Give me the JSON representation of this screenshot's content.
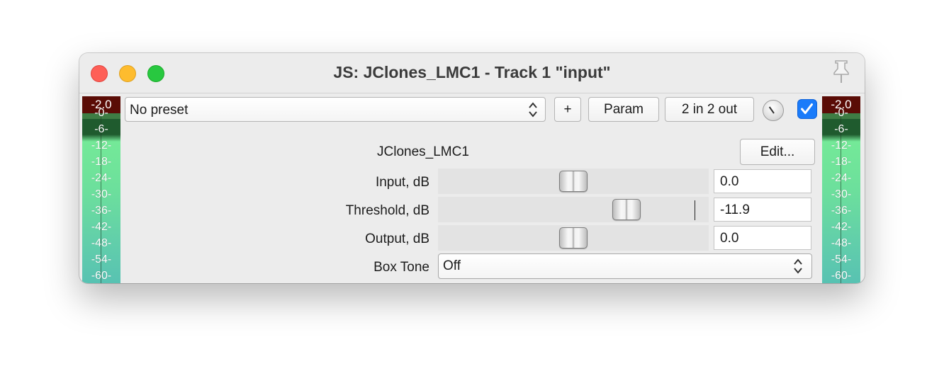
{
  "window": {
    "title": "JS: JClones_LMC1 - Track 1 \"input\""
  },
  "meters": {
    "left": {
      "peak": "-2.0",
      "ticks": [
        "-0-",
        "-6-",
        "-12-",
        "-18-",
        "-24-",
        "-30-",
        "-36-",
        "-42-",
        "-48-",
        "-54-",
        "-60-"
      ]
    },
    "right": {
      "peak": "-2.0",
      "ticks": [
        "-0-",
        "-6-",
        "-12-",
        "-18-",
        "-24-",
        "-30-",
        "-36-",
        "-42-",
        "-48-",
        "-54-",
        "-60-"
      ]
    }
  },
  "toolbar": {
    "preset": "No preset",
    "plus_label": "+",
    "param_label": "Param",
    "io_label": "2 in 2 out",
    "enabled": true
  },
  "plugin": {
    "name": "JClones_LMC1",
    "edit_label": "Edit...",
    "params": [
      {
        "label": "Input, dB",
        "value": "0.0",
        "slider_fraction": 0.5
      },
      {
        "label": "Threshold, dB",
        "value": "-11.9",
        "slider_fraction": 0.72
      },
      {
        "label": "Output, dB",
        "value": "0.0",
        "slider_fraction": 0.5
      }
    ],
    "box_tone": {
      "label": "Box Tone",
      "value": "Off"
    }
  },
  "icons": {
    "close": "close-traffic-light",
    "minimize": "minimize-traffic-light",
    "zoom": "zoom-traffic-light",
    "pin": "pin-icon",
    "knob": "wet-knob-icon",
    "checkbox": "checkmark-icon",
    "updown": "updown-chevron-icon"
  },
  "colors": {
    "close": "#fe5f57",
    "minimize": "#febc2e",
    "zoom": "#28c840",
    "checkbox": "#1a7bfa",
    "meter_peak": "#5a0c06"
  }
}
